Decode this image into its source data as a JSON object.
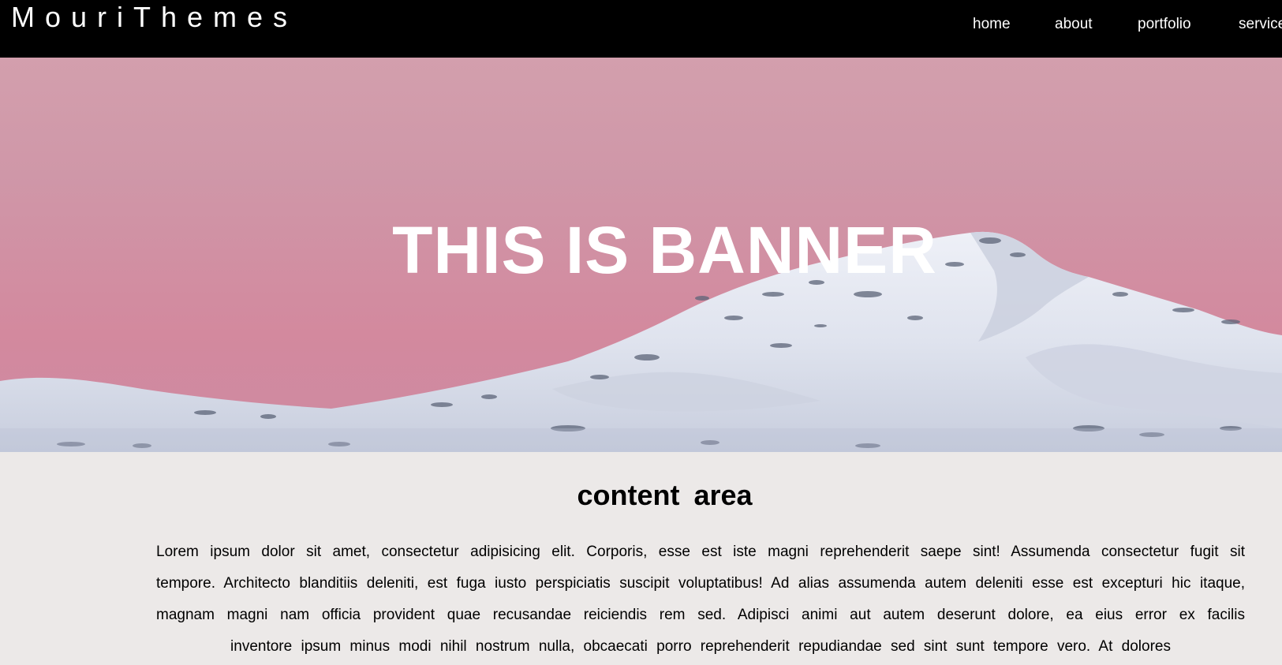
{
  "header": {
    "logo": "MouriThemes",
    "nav": {
      "home": "home",
      "about": "about",
      "portfolio": "portfolio",
      "services": "services"
    }
  },
  "banner": {
    "title": "THIS IS BANNER"
  },
  "content": {
    "title": "content  area",
    "paragraph": "Lorem ipsum dolor sit amet, consectetur adipisicing elit. Corporis, esse est iste magni reprehenderit saepe sint! Assumenda consectetur fugit sit tempore. Architecto blanditiis deleniti, est fuga iusto perspiciatis suscipit voluptatibus! Ad alias assumenda autem deleniti esse est excepturi hic itaque, magnam magni nam officia provident quae recusandae reiciendis rem sed. Adipisci animi aut autem deserunt dolore, ea eius error ex facilis inventore ipsum minus modi nihil nostrum nulla, obcaecati porro reprehenderit repudiandae sed sint sunt tempore vero. At dolores"
  },
  "colors": {
    "header_bg": "#000000",
    "sky_pink": "#d39fad",
    "content_bg": "#ece9e8"
  }
}
